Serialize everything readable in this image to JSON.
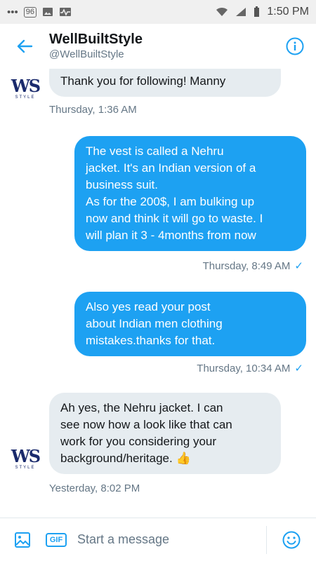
{
  "status_bar": {
    "time": "1:50 PM",
    "notification_count": "96"
  },
  "header": {
    "title": "WellBuiltStyle",
    "subtitle": "@WellBuiltStyle"
  },
  "avatar": {
    "logo": "WS",
    "sub": "STYLE"
  },
  "messages": [
    {
      "direction": "in",
      "lines": [
        "Thank you for following! Manny"
      ],
      "timestamp": "Thursday, 1:36 AM"
    },
    {
      "direction": "out",
      "lines": [
        "The vest is called a Nehru",
        "jacket. It's an Indian version of a",
        "business suit.",
        "As for the 200$, I am bulking up",
        "now and think it will go to waste. I",
        "will plan it 3 - 4months from now"
      ],
      "timestamp": "Thursday, 8:49 AM",
      "read_mark": "✓"
    },
    {
      "direction": "out",
      "lines": [
        "Also yes read your post",
        "about Indian men clothing",
        "mistakes.thanks for that."
      ],
      "timestamp": "Thursday, 10:34 AM",
      "read_mark": "✓"
    },
    {
      "direction": "in",
      "lines": [
        "Ah yes, the Nehru jacket. I can",
        "see now how a look like that can",
        "work for you considering your",
        "background/heritage. 👍"
      ],
      "timestamp": "Yesterday, 8:02 PM"
    }
  ],
  "composer": {
    "gif_label": "GIF",
    "placeholder": "Start a message"
  },
  "colors": {
    "accent": "#1da1f2",
    "incoming_bubble": "#e6ecf0",
    "meta_text": "#657786"
  }
}
